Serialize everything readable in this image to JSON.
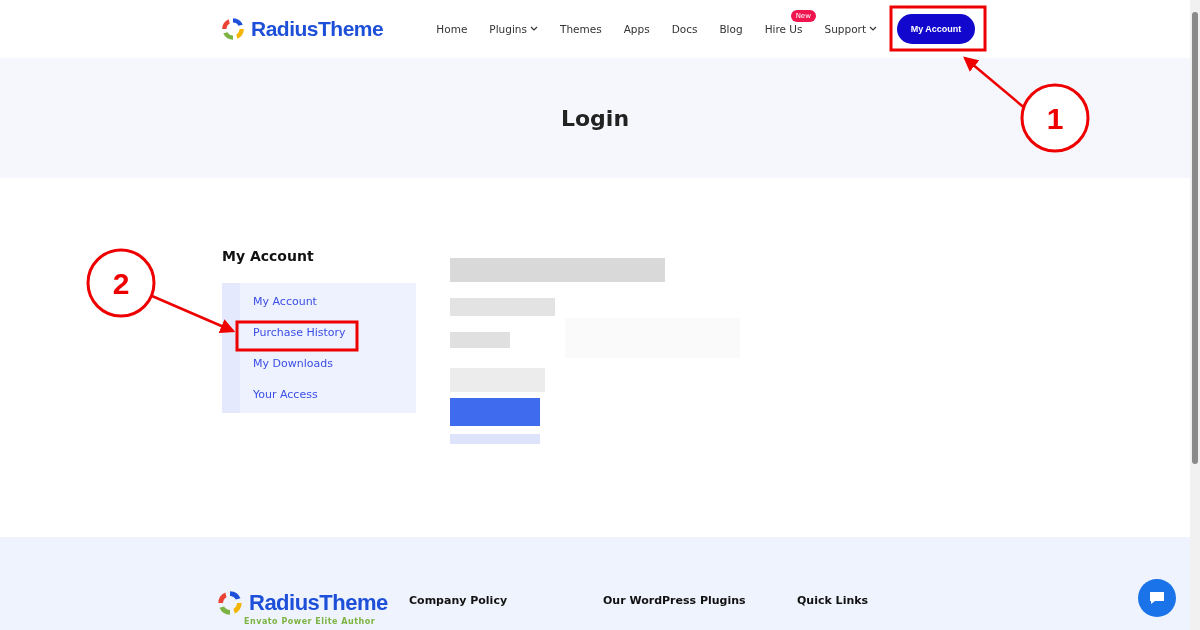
{
  "header": {
    "logo": "RadiusTheme",
    "nav": [
      {
        "label": "Home",
        "dropdown": false
      },
      {
        "label": "Plugins",
        "dropdown": true
      },
      {
        "label": "Themes",
        "dropdown": false
      },
      {
        "label": "Apps",
        "dropdown": false
      },
      {
        "label": "Docs",
        "dropdown": false
      },
      {
        "label": "Blog",
        "dropdown": false
      },
      {
        "label": "Hire Us",
        "dropdown": false,
        "badge": "New"
      },
      {
        "label": "Support",
        "dropdown": true
      }
    ],
    "account_button": "My Account"
  },
  "hero": {
    "title": "Login"
  },
  "sidebar": {
    "title": "My Account",
    "items": [
      {
        "label": "My Account"
      },
      {
        "label": "Purchase History"
      },
      {
        "label": "My Downloads"
      },
      {
        "label": "Your Access"
      }
    ]
  },
  "footer": {
    "logo": "RadiusTheme",
    "tagline": "Envato Power Elite Author",
    "columns": [
      {
        "heading": "Company Policy"
      },
      {
        "heading": "Our WordPress Plugins"
      },
      {
        "heading": "Quick Links"
      }
    ]
  },
  "annotations": [
    {
      "number": "1"
    },
    {
      "number": "2"
    }
  ]
}
